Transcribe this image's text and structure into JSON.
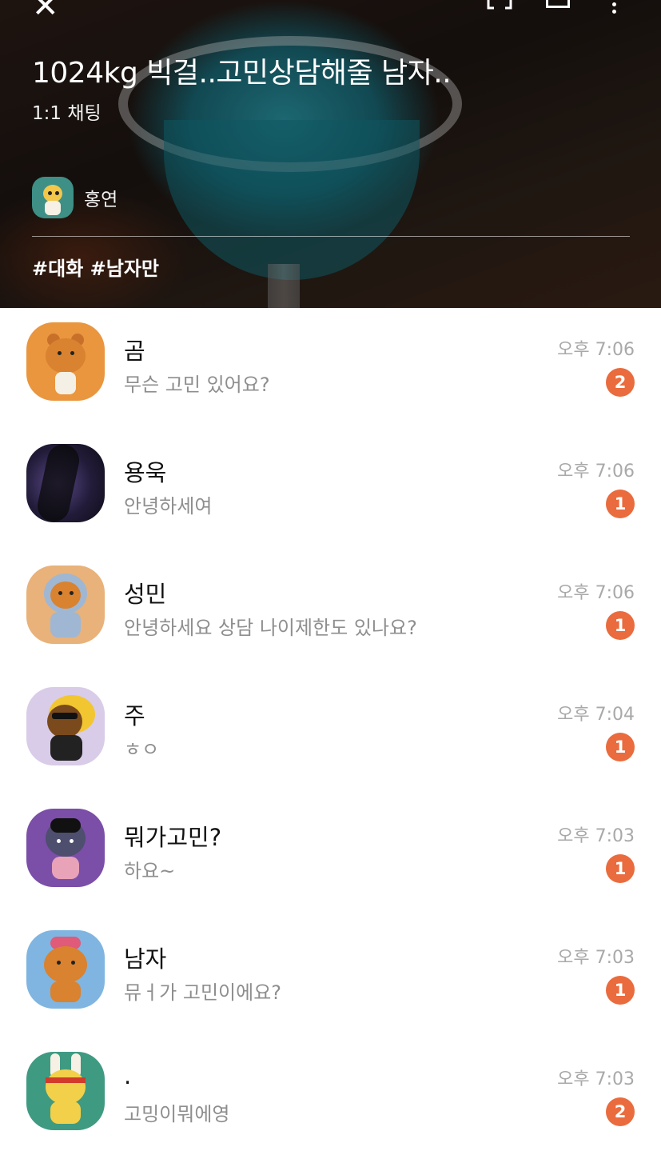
{
  "header": {
    "title": "1024kg 빅걸..고민상담해줄 남자..",
    "subtitle": "1:1 채팅",
    "host_name": "홍연",
    "tags": "#대화 #남자만",
    "icons": [
      "close-icon",
      "expand-icon",
      "share-icon",
      "more-icon"
    ]
  },
  "chats": [
    {
      "name": "곰",
      "message": "무슨 고민 있어요?",
      "time": "오후 7:06",
      "unread": "2",
      "avatar_bg": "#e9963f"
    },
    {
      "name": "용욱",
      "message": "안녕하세여",
      "time": "오후 7:06",
      "unread": "1",
      "avatar_bg": "#2a2340"
    },
    {
      "name": "성민",
      "message": "안녕하세요 상담 나이제한도 있나요?",
      "time": "오후 7:06",
      "unread": "1",
      "avatar_bg": "#e8b27a"
    },
    {
      "name": "주",
      "message": "ㅎㅇ",
      "time": "오후 7:04",
      "unread": "1",
      "avatar_bg": "#d9cce8"
    },
    {
      "name": "뭐가고민?",
      "message": "하요~",
      "time": "오후 7:03",
      "unread": "1",
      "avatar_bg": "#7b4ea8"
    },
    {
      "name": "남자",
      "message": "뮤ㅓ가 고민이에요?",
      "time": "오후 7:03",
      "unread": "1",
      "avatar_bg": "#7fb5e0"
    },
    {
      "name": ".",
      "message": "고밍이뭐에영",
      "time": "오후 7:03",
      "unread": "2",
      "avatar_bg": "#3f9a82"
    }
  ],
  "colors": {
    "badge": "#ea6b3d",
    "name": "#111111",
    "message": "#8e8e8e",
    "time": "#a9a9a9"
  }
}
